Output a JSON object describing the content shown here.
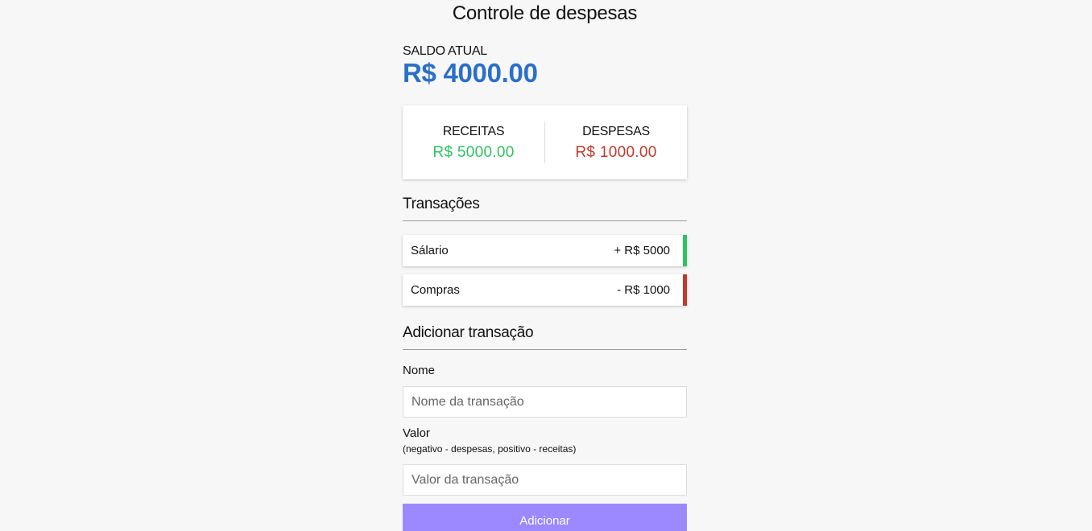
{
  "header": {
    "title": "Controle de despesas"
  },
  "balance": {
    "label": "SALDO ATUAL",
    "value": "R$ 4000.00"
  },
  "summary": {
    "income_label": "RECEITAS",
    "income_value": "R$ 5000.00",
    "expense_label": "DESPESAS",
    "expense_value": "R$ 1000.00"
  },
  "transactions": {
    "title": "Transações",
    "items": [
      {
        "name": "Sálario",
        "amount": "+ R$ 5000",
        "type": "plus"
      },
      {
        "name": "Compras",
        "amount": "- R$ 1000",
        "type": "minus"
      }
    ]
  },
  "form": {
    "title": "Adicionar transação",
    "name_label": "Nome",
    "name_placeholder": "Nome da transação",
    "name_value": "",
    "amount_label": "Valor",
    "amount_hint": "(negativo - despesas, positivo - receitas)",
    "amount_placeholder": "Valor da transação",
    "amount_value": "",
    "submit_label": "Adicionar"
  },
  "colors": {
    "balance": "#2b6fc9",
    "income": "#2ec262",
    "expense": "#c0392b",
    "button": "#9c88ff",
    "background": "#f7f7f7"
  }
}
